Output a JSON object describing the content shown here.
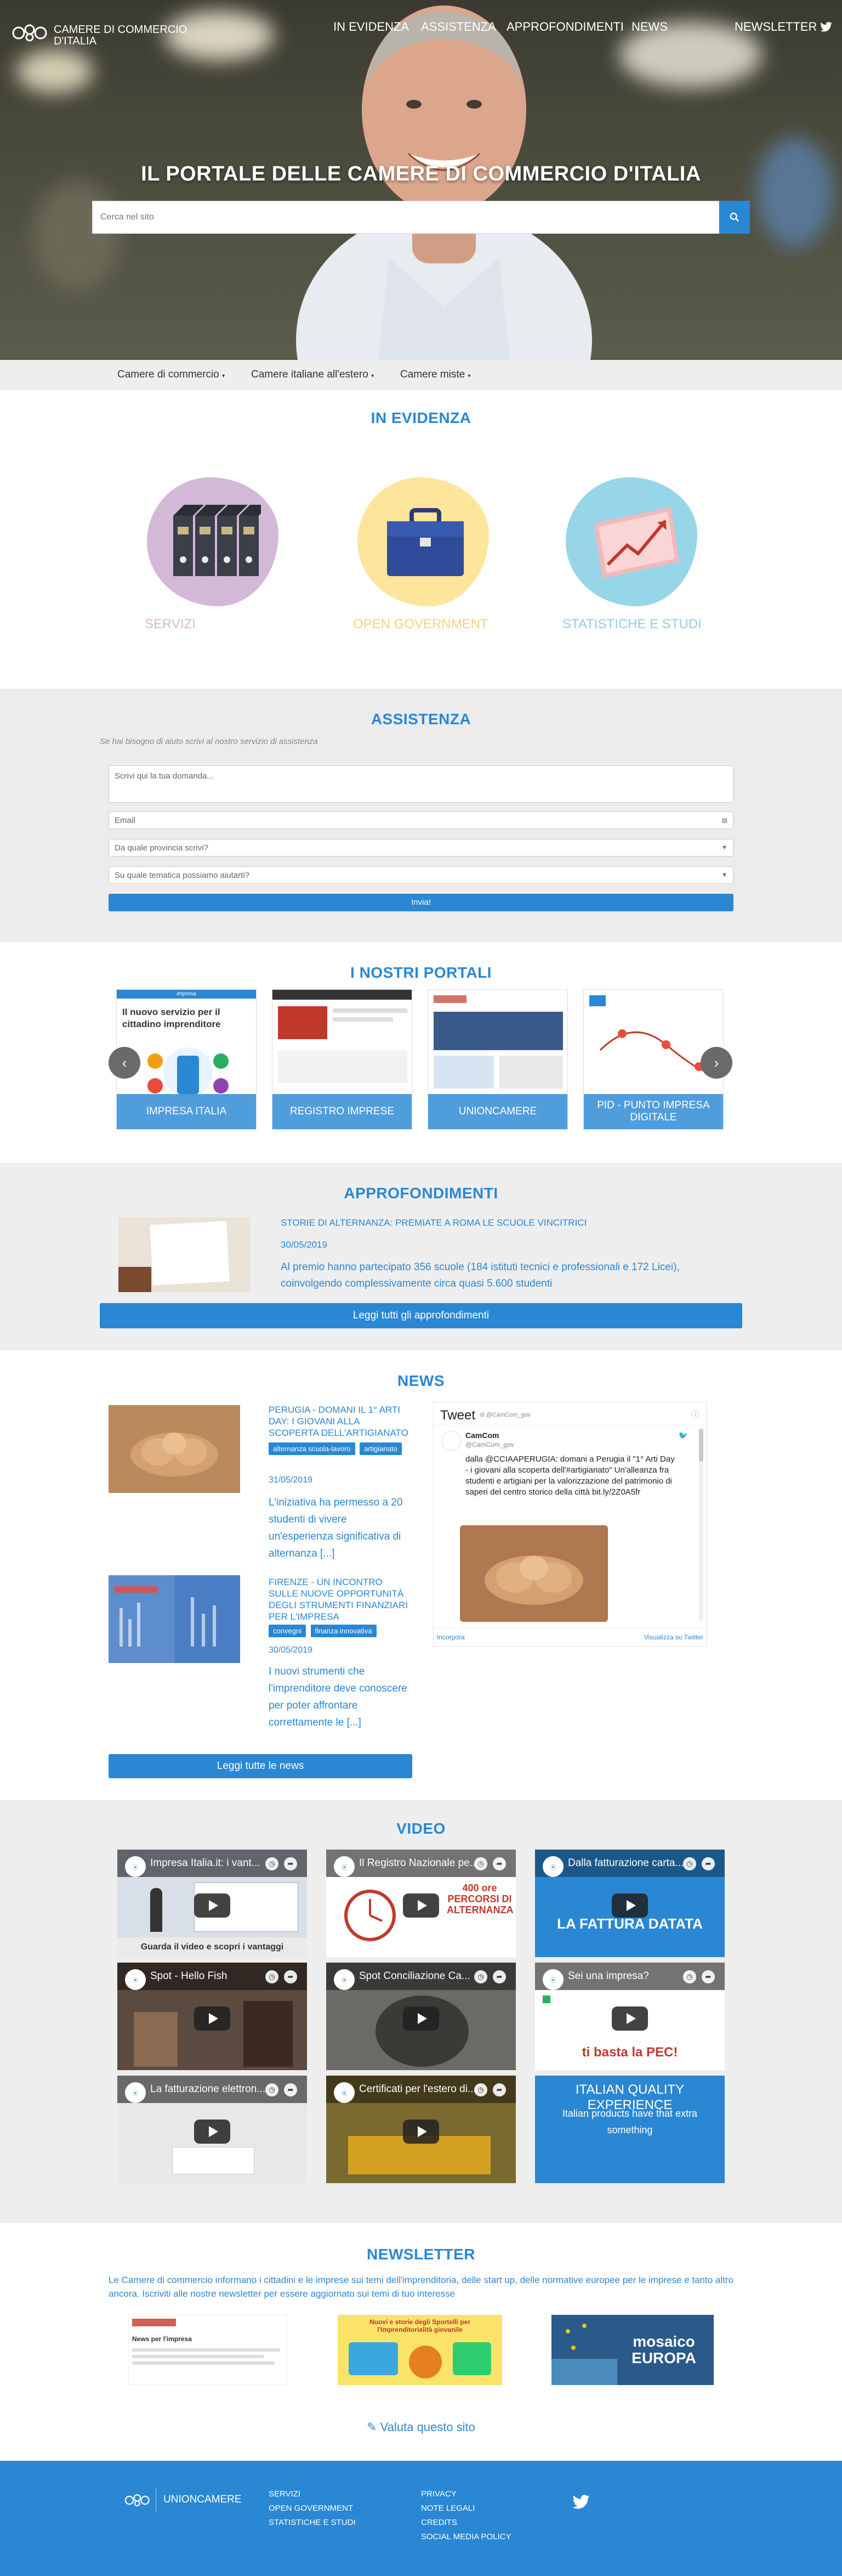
{
  "header": {
    "logo_text_line1": "CAMERE DI COMMERCIO",
    "logo_text_line2": "D'ITALIA",
    "nav": [
      "IN EVIDENZA",
      "ASSISTENZA",
      "APPROFONDIMENTI",
      "NEWS",
      "NEWSLETTER"
    ],
    "twitter_icon": "twitter-icon"
  },
  "hero": {
    "title": "IL PORTALE DELLE CAMERE DI COMMERCIO D'ITALIA",
    "search_placeholder": "Cerca nel sito",
    "search_icon": "search-icon"
  },
  "subnav": [
    "Camere di commercio",
    "Camere italiane all'estero",
    "Camere miste"
  ],
  "evidenza": {
    "title": "IN EVIDENZA",
    "cards": [
      {
        "label": "SERVIZI",
        "color": "#d4b8d8",
        "label_color": "#d9b8dc"
      },
      {
        "label": "OPEN GOVERNMENT",
        "color": "#fde59c",
        "label_color": "#f5d27f"
      },
      {
        "label": "STATISTICHE E STUDI",
        "color": "#96d6e8",
        "label_color": "#8fd0e0"
      }
    ]
  },
  "assistenza": {
    "title": "ASSISTENZA",
    "subtitle": "Se hai bisogno di aiuto scrivi al nostro servizio di assistenza",
    "question_placeholder": "Scrivi qui la tua domanda...",
    "email_placeholder": "Email",
    "province_select": "Da quale provincia scrivi?",
    "topic_select": "Su quale tematica possiamo aiutarti?",
    "submit": "Invia!"
  },
  "portali": {
    "title": "I NOSTRI PORTALI",
    "items": [
      "IMPRESA ITALIA",
      "REGISTRO IMPRESE",
      "UNIONCAMERE",
      "PID - PUNTO IMPRESA DIGITALE"
    ],
    "impresa_header": "impresa",
    "impresa_text": "Il nuovo servizio per il cittadino imprenditore",
    "prev_icon": "chevron-left-icon",
    "next_icon": "chevron-right-icon"
  },
  "approfondimenti": {
    "title": "APPROFONDIMENTI",
    "article_title": "STORIE DI ALTERNANZA: PREMIATE A ROMA LE SCUOLE VINCITRICI",
    "article_date": "30/05/2019",
    "article_text": "Al premio hanno partecipato 356 scuole (184 istituti tecnici e professionali e 172 Licei), coinvolgendo complessivamente circa quasi 5.600 studenti",
    "button": "Leggi tutti gli approfondimenti"
  },
  "news": {
    "title": "NEWS",
    "items": [
      {
        "title": "PERUGIA - DOMANI IL 1° ARTI DAY: I GIOVANI ALLA SCOPERTA DELL'ARTIGIANATO",
        "tags": [
          "alternanza scuola-lavoro",
          "artigianato"
        ],
        "date": "31/05/2019",
        "excerpt": "L'iniziativa ha permesso a 20 studenti di vivere un'esperienza significativa di alternanza [...]"
      },
      {
        "title": "FIRENZE - UN INCONTRO SULLE NUOVE OPPORTUNITÀ DEGLI STRUMENTI FINANZIARI PER L'IMPRESA",
        "tags": [
          "convegni",
          "finanza innovativa"
        ],
        "date": "30/05/2019",
        "excerpt": "I nuovi strumenti che l'imprenditore deve conoscere per poter affrontare correttamente le [...]"
      }
    ],
    "button": "Leggi tutte le news",
    "twitter": {
      "header": "Tweet",
      "by": "di @CamCom_gov",
      "account_name": "CamCom",
      "account_handle": "@CamCom_gov",
      "tweet_text": "dalla @CCIAAPERUGIA: domani a Perugia il \"1° Arti Day - i giovani alla scoperta dell'#artigianato\" Un'alleanza fra studenti e artigiani per la valorizzazione del patrimonio di saperi del centro storico della città bit.ly/2Z0A5fr",
      "embed": "Incorpora",
      "view": "Visualizza su Twitter"
    }
  },
  "video": {
    "title": "VIDEO",
    "items": [
      {
        "title": "Impresa Italia.it: i vant...",
        "caption": "Guarda il video e scopri i vantaggi",
        "bg": "#d8dfe8"
      },
      {
        "title": "Il Registro Nazionale pe...",
        "caption": "400 ore PERCORSI DI ALTERNANZA",
        "bg": "#ffffff"
      },
      {
        "title": "Dalla fatturazione carta...",
        "caption": "LA FATTURA DATATA",
        "bg": "#2a87d3"
      },
      {
        "title": "Spot - Hello Fish",
        "caption": "",
        "bg": "#5a4a40"
      },
      {
        "title": "Spot Conciliazione Ca...",
        "caption": "",
        "bg": "#6b6a66"
      },
      {
        "title": "Sei una impresa?",
        "caption": "ti basta la PEC!",
        "bg": "#ffffff"
      },
      {
        "title": "La fatturazione elettron...",
        "caption": "",
        "bg": "#e8e8e8"
      },
      {
        "title": "Certificati per l'estero di...",
        "caption": "",
        "bg": "#7a6a30"
      },
      {
        "title": "ITALIAN QUALITY EXPERIENCE",
        "caption": "Italian products have that extra something",
        "bg": "#2a87d3"
      }
    ]
  },
  "newsletter": {
    "title": "NEWSLETTER",
    "text": "Le Camere di commercio informano i cittadini e le imprese sui temi dell'imprenditoria, delle start up, delle normative europee per le imprese e tanto altro ancora. Iscriviti alle nostre newsletter per essere aggiornato sui temi di tuo interesse",
    "news1_title": "News per l'impresa",
    "news2_title": "Nuovi e storie degli Sportelli per l'Imprenditorialità giovanile",
    "news3_title": "mosaico EUROPA",
    "rate_link": "Valuta questo sito"
  },
  "footer": {
    "brand": "UNIONCAMERE",
    "col1": [
      "SERVIZI",
      "OPEN GOVERNMENT",
      "STATISTICHE E STUDI"
    ],
    "col2": [
      "PRIVACY",
      "NOTE LEGALI",
      "CREDITS",
      "SOCIAL MEDIA POLICY"
    ],
    "twitter_icon": "twitter-icon"
  }
}
